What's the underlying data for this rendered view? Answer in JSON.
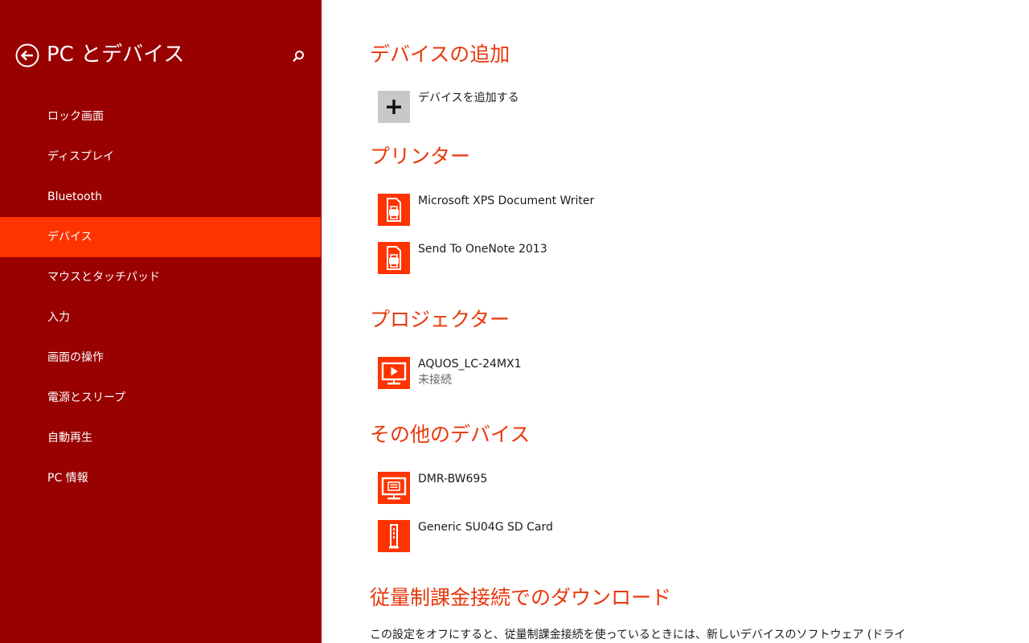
{
  "sidebar": {
    "title": "PC とデバイス",
    "items": [
      {
        "label": "ロック画面"
      },
      {
        "label": "ディスプレイ"
      },
      {
        "label": "Bluetooth"
      },
      {
        "label": "デバイス"
      },
      {
        "label": "マウスとタッチパッド"
      },
      {
        "label": "入力"
      },
      {
        "label": "画面の操作"
      },
      {
        "label": "電源とスリープ"
      },
      {
        "label": "自動再生"
      },
      {
        "label": "PC 情報"
      }
    ],
    "active_item": "デバイス"
  },
  "main": {
    "add_section": {
      "heading": "デバイスの追加",
      "add_label": "デバイスを追加する"
    },
    "printers": {
      "heading": "プリンター",
      "devices": [
        {
          "name": "Microsoft XPS Document Writer"
        },
        {
          "name": "Send To OneNote 2013"
        }
      ]
    },
    "projectors": {
      "heading": "プロジェクター",
      "devices": [
        {
          "name": "AQUOS_LC-24MX1",
          "status": "未接続"
        }
      ]
    },
    "other": {
      "heading": "その他のデバイス",
      "devices": [
        {
          "name": "DMR-BW695"
        },
        {
          "name": "Generic SU04G SD Card"
        }
      ]
    },
    "metered": {
      "heading": "従量制課金接続でのダウンロード",
      "description": "この設定をオフにすると、従量制課金接続を使っているときには、新しいデバイスのソフトウェア (ドライ"
    }
  },
  "icons": {
    "back": "back-arrow-icon",
    "search": "search-icon",
    "add": "plus-icon",
    "printer": "printer-icon",
    "projector": "projector-icon",
    "monitor": "monitor-icon",
    "storage": "storage-drive-icon"
  },
  "colors": {
    "sidebar_bg": "#990000",
    "accent": "#ff3300",
    "heading": "#e8380d"
  }
}
